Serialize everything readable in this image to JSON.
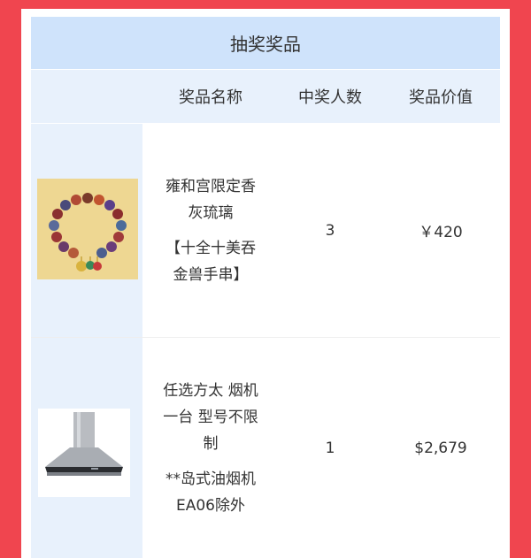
{
  "title": "抽奖奖品",
  "headers": {
    "name": "奖品名称",
    "count": "中奖人数",
    "value": "奖品价值"
  },
  "prizes": [
    {
      "image_icon": "bracelet-photo",
      "name_line1": "雍和宫限定香",
      "name_line2": "灰琉璃",
      "name_line3": "【十全十美吞",
      "name_line4": "金兽手串】",
      "count": "3",
      "value": "￥420"
    },
    {
      "image_icon": "range-hood-photo",
      "name_line1": "任选方太 烟机",
      "name_line2": "一台 型号不限",
      "name_line3": "制",
      "name_line4": "**岛式油烟机",
      "name_line5": "EA06除外",
      "count": "1",
      "value": "$2,679"
    }
  ]
}
